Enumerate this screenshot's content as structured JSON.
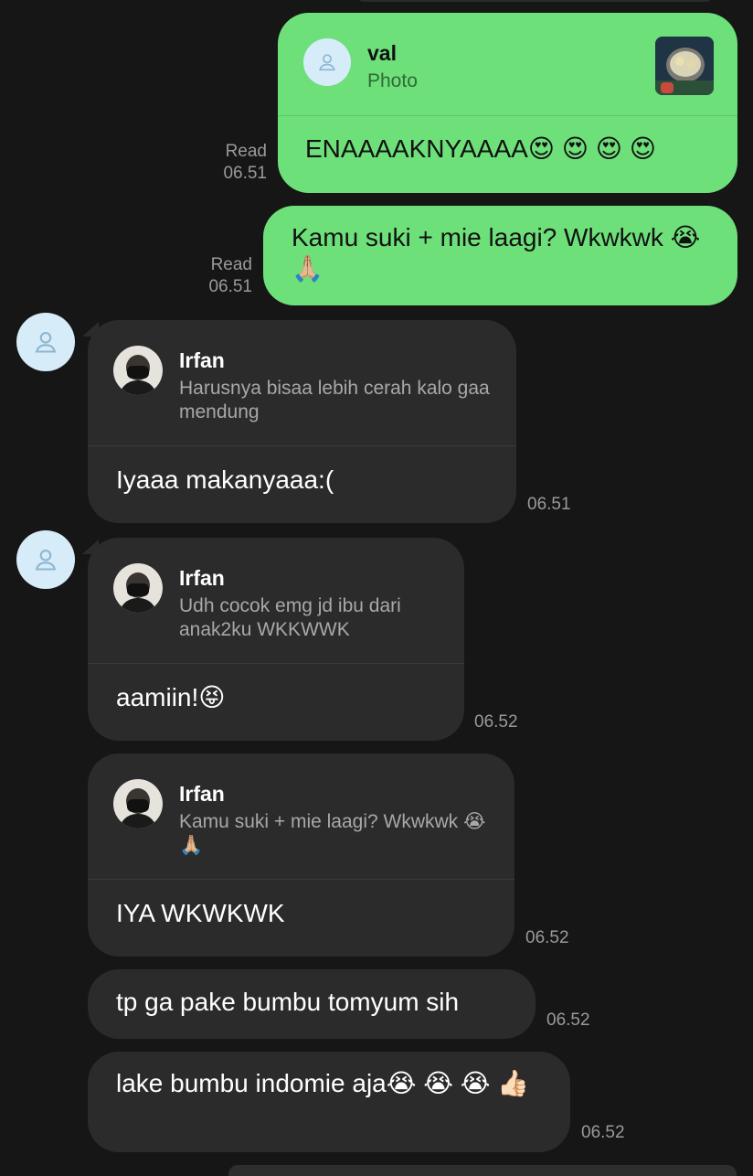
{
  "messages": {
    "m1": {
      "reply_name": "val",
      "reply_text": "Photo",
      "text": "ENAAAAKNYAAAA😍 😍 😍 😍",
      "read_label": "Read",
      "time": "06.51"
    },
    "m2": {
      "text": "Kamu suki + mie laagi? Wkwkwk 😭🙏🏼",
      "read_label": "Read",
      "time": "06.51"
    },
    "m3": {
      "reply_name": "Irfan",
      "reply_text": "Harusnya bisaa lebih cerah kalo gaa mendung",
      "text": "Iyaaa makanyaaa:(",
      "time": "06.51"
    },
    "m4": {
      "reply_name": "Irfan",
      "reply_text": "Udh cocok emg jd ibu dari anak2ku WKKWWK",
      "text": "aamiin!😝",
      "time": "06.52"
    },
    "m5": {
      "reply_name": "Irfan",
      "reply_text": "Kamu suki + mie laagi? Wkwkwk 😭🙏🏼",
      "text": "IYA WKWKWK",
      "time": "06.52"
    },
    "m6": {
      "text": "tp ga pake bumbu tomyum sih",
      "time": "06.52"
    },
    "m7": {
      "text": "lake bumbu indomie aja😭 😭 😭 👍🏻",
      "time": "06.52"
    }
  },
  "colors": {
    "background": "#161616",
    "outgoing_bubble": "#6ee07a",
    "incoming_bubble": "#2b2b2b",
    "avatar_placeholder": "#d6ecf8"
  },
  "icons": {
    "avatar_placeholder": "user-silhouette-icon"
  }
}
